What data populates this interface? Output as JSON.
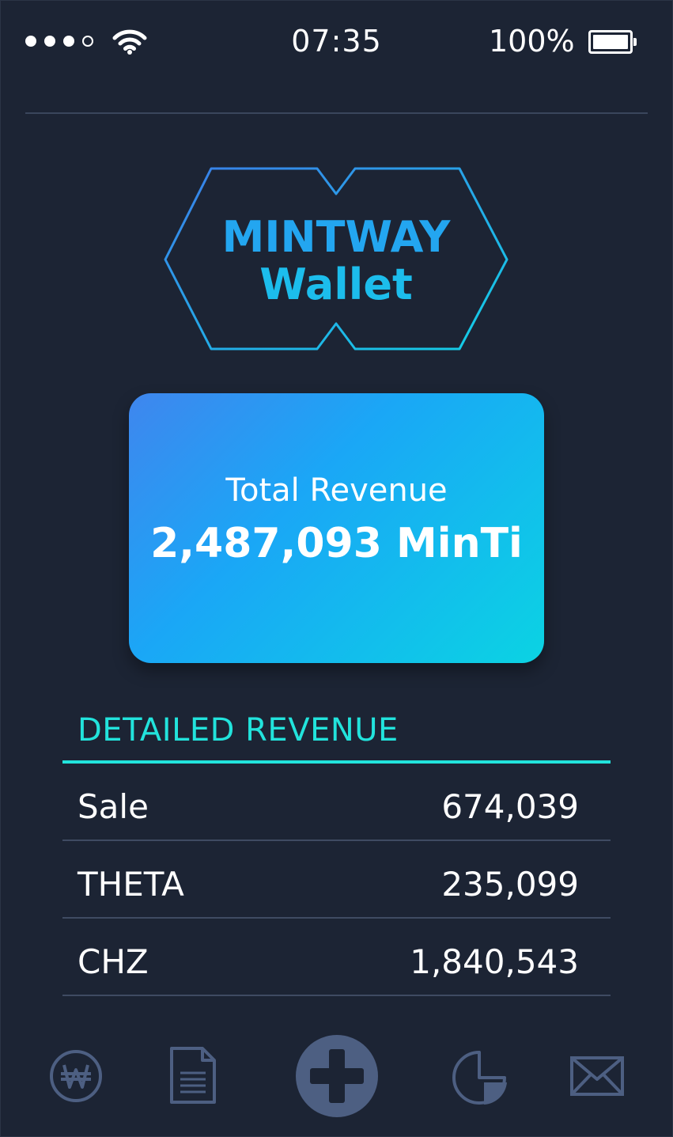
{
  "status_bar": {
    "time": "07:35",
    "battery_percent": "100%",
    "signal_bars_filled": 3,
    "signal_bars_total": 4,
    "battery_level": 1.0
  },
  "logo": {
    "line1": "MINTWAY",
    "line2": "Wallet"
  },
  "revenue_card": {
    "label": "Total Revenue",
    "value": "2,487,093 MinTi"
  },
  "detailed_revenue": {
    "title": "DETAILED REVENUE",
    "rows": [
      {
        "label": "Sale",
        "value": "674,039"
      },
      {
        "label": "THETA",
        "value": "235,099"
      },
      {
        "label": "CHZ",
        "value": "1,840,543"
      }
    ]
  },
  "bottom_nav": {
    "items": [
      "won-coin-icon",
      "document-icon",
      "add-icon",
      "pie-chart-icon",
      "mail-icon"
    ]
  },
  "colors": {
    "background": "#1c2434",
    "accent": "#22e3dc",
    "card_gradient_start": "#3f86ee",
    "card_gradient_end": "#0bd3e3",
    "nav_icon": "#4d5f82"
  }
}
